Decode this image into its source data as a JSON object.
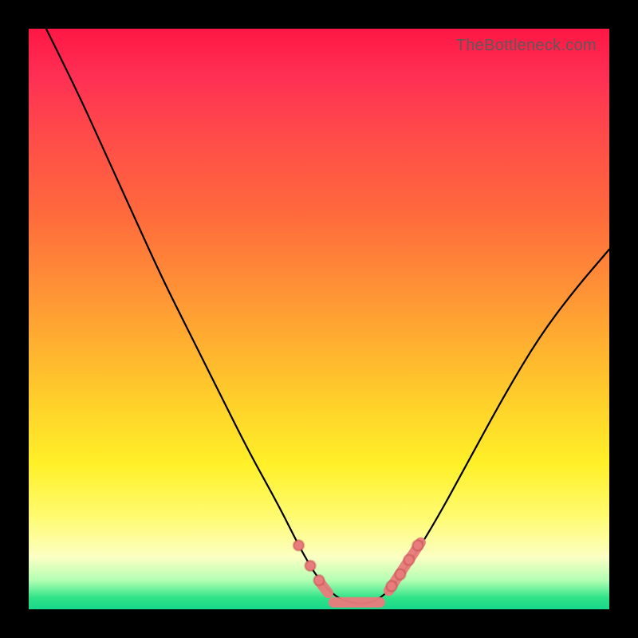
{
  "watermark": "TheBottleneck.com",
  "colors": {
    "background": "#000000",
    "curve": "#000000",
    "marker": "#e87c7c",
    "gradient_top": "#ff1744",
    "gradient_bottom": "#17d88a"
  },
  "chart_data": {
    "type": "line",
    "title": "",
    "xlabel": "",
    "ylabel": "",
    "xlim": [
      0,
      100
    ],
    "ylim": [
      0,
      100
    ],
    "series": [
      {
        "name": "bottleneck-curve",
        "x": [
          3,
          8,
          13,
          18,
          23,
          28,
          33,
          38,
          43,
          47,
          50,
          53,
          56,
          59,
          62,
          65,
          70,
          76,
          82,
          88,
          94,
          100
        ],
        "y": [
          100,
          90,
          79,
          68,
          57,
          47,
          37,
          27,
          18,
          10,
          5,
          2,
          1,
          1,
          3,
          7,
          15,
          26,
          37,
          47,
          55,
          62
        ]
      }
    ],
    "annotations": {
      "marker_color": "#e87c7c",
      "left_dots_x": [
        46.5,
        48.5,
        50.0
      ],
      "left_dots_y": [
        11.0,
        7.5,
        5.0
      ],
      "right_dots_x": [
        62.5,
        64.0,
        65.5,
        67.0
      ],
      "right_dots_y": [
        4.0,
        6.0,
        8.5,
        11.0
      ],
      "bottom_segment": {
        "x1": 52.5,
        "x2": 60.5,
        "y": 1.2
      },
      "left_short_segment": {
        "x1": 50.2,
        "y1": 4.6,
        "x2": 51.6,
        "y2": 2.8
      },
      "right_short_segment": {
        "x1": 62.0,
        "y1": 3.2,
        "x2": 67.5,
        "y2": 11.5
      }
    }
  }
}
